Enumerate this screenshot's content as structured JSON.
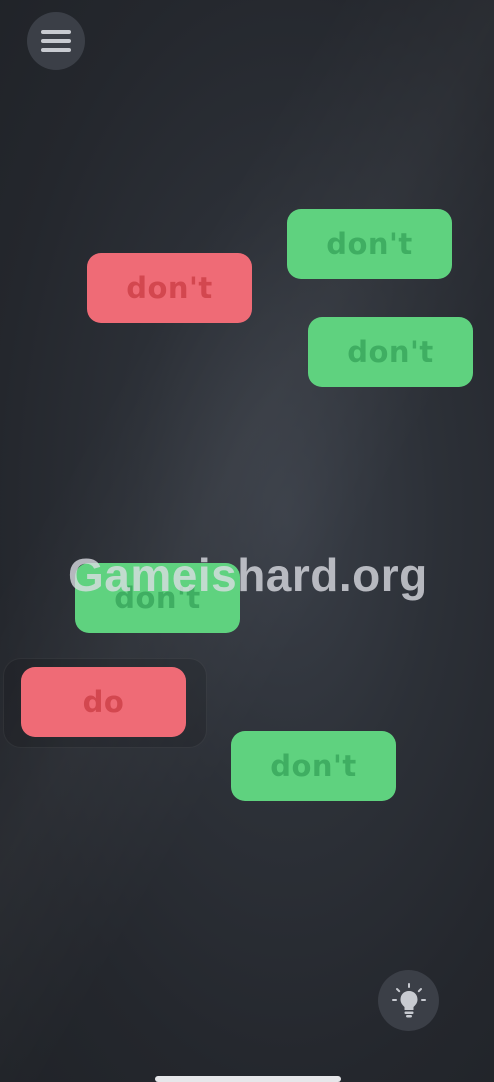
{
  "menu": {
    "icon": "hamburger-menu-icon"
  },
  "hint": {
    "icon": "lightbulb-icon"
  },
  "tiles": [
    {
      "label": "don't",
      "color": "green"
    },
    {
      "label": "don't",
      "color": "red"
    },
    {
      "label": "don't",
      "color": "green"
    },
    {
      "label": "don't",
      "color": "green"
    },
    {
      "label": "do",
      "color": "red",
      "selected": true
    },
    {
      "label": "don't",
      "color": "green"
    }
  ],
  "watermark": "Gameishard.org",
  "colors": {
    "green_tile": "#5fd27f",
    "red_tile": "#ef6b76",
    "background": "#2c3037"
  }
}
